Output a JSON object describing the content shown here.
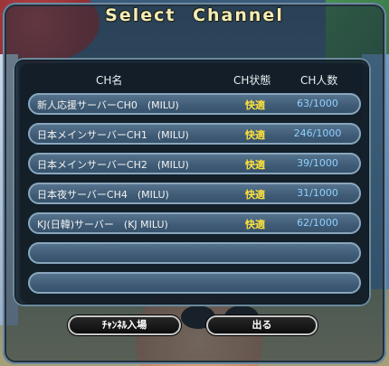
{
  "title": "Select Channel",
  "columns": {
    "name": "CH名",
    "state": "CH状態",
    "count": "CH人数"
  },
  "channels": [
    {
      "name": "新人応援サーバーCH0　(MILU)",
      "state": "快適",
      "count": "63/1000"
    },
    {
      "name": "日本メインサーバーCH1　(MILU)",
      "state": "快適",
      "count": "246/1000"
    },
    {
      "name": "日本メインサーバーCH2　(MILU)",
      "state": "快適",
      "count": "39/1000"
    },
    {
      "name": "日本夜サーバーCH4　(MILU)",
      "state": "快適",
      "count": "31/1000"
    },
    {
      "name": "KJ(日韓)サーバー　(KJ MILU)",
      "state": "快適",
      "count": "62/1000"
    },
    {
      "name": "",
      "state": "",
      "count": ""
    },
    {
      "name": "",
      "state": "",
      "count": ""
    }
  ],
  "buttons": {
    "enter": "ﾁｬﾝﾈﾙ入場",
    "exit": "出る"
  },
  "colors": {
    "state": "#ffe23a",
    "count": "#8fd0ff",
    "title": "#f4ecb8"
  }
}
